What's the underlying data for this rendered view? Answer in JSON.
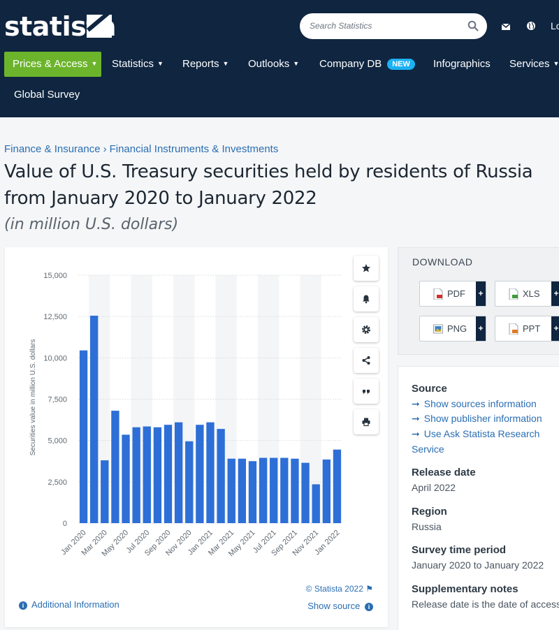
{
  "header": {
    "logo_text": "statista",
    "search_placeholder": "Search Statistics",
    "login_label": "Lo",
    "nav": {
      "prices": "Prices & Access",
      "statistics": "Statistics",
      "reports": "Reports",
      "outlooks": "Outlooks",
      "company_db": "Company DB",
      "new_badge": "NEW",
      "infographics": "Infographics",
      "services": "Services",
      "global_survey": "Global Survey"
    }
  },
  "breadcrumb": {
    "item1": "Finance & Insurance",
    "item2": "Financial Instruments & Investments"
  },
  "page": {
    "title": "Value of U.S. Treasury securities held by residents of Russia from January 2020 to January 2022",
    "subtitle": "(in million U.S. dollars)"
  },
  "chart_footer": {
    "copyright": "© Statista 2022",
    "additional_info": "Additional Information",
    "show_source": "Show source"
  },
  "download": {
    "title": "DOWNLOAD",
    "pdf": "PDF",
    "xls": "XLS",
    "png": "PNG",
    "ppt": "PPT",
    "plus": "+"
  },
  "info": {
    "source_head": "Source",
    "source_links": [
      "Show sources information",
      "Show publisher information",
      "Use Ask Statista Research"
    ],
    "service_text": "Service",
    "release_head": "Release date",
    "release_val": "April 2022",
    "region_head": "Region",
    "region_val": "Russia",
    "survey_head": "Survey time period",
    "survey_val": "January 2020 to January 2022",
    "notes_head": "Supplementary notes",
    "notes_val": "Release date is the date of access."
  },
  "colors": {
    "bar": "#2d6fd6",
    "nav_bg": "#0f2540",
    "accent_green": "#6cb42c",
    "link": "#2a6eb3"
  },
  "chart_data": {
    "type": "bar",
    "ylabel": "Securities value in million U.S. dollars",
    "xlabel": "",
    "ylim": [
      0,
      15000
    ],
    "yticks": [
      0,
      2500,
      5000,
      7500,
      10000,
      12500,
      15000
    ],
    "ytick_labels": [
      "0",
      "2,500",
      "5,000",
      "7,500",
      "10,000",
      "12,500",
      "15,000"
    ],
    "categories": [
      "Jan 2020",
      "Feb 2020",
      "Mar 2020",
      "Apr 2020",
      "May 2020",
      "Jun 2020",
      "Jul 2020",
      "Aug 2020",
      "Sep 2020",
      "Oct 2020",
      "Nov 2020",
      "Dec 2020",
      "Jan 2021",
      "Feb 2021",
      "Mar 2021",
      "Apr 2021",
      "May 2021",
      "Jun 2021",
      "Jul 2021",
      "Aug 2021",
      "Sep 2021",
      "Oct 2021",
      "Nov 2021",
      "Dec 2021",
      "Jan 2022"
    ],
    "values": [
      10450,
      12550,
      3800,
      6800,
      5350,
      5800,
      5850,
      5800,
      5950,
      6100,
      4950,
      5950,
      6100,
      5700,
      3900,
      3900,
      3750,
      3950,
      3950,
      3950,
      3900,
      3650,
      2350,
      3850,
      4450
    ],
    "visible_xtick_labels": [
      "Jan 2020",
      "Mar 2020",
      "May 2020",
      "Jul 2020",
      "Sep 2020",
      "Nov 2020",
      "Jan 2021",
      "Mar 2021",
      "May 2021",
      "Jul 2021",
      "Sep 2021",
      "Nov 2021",
      "Jan 2022"
    ],
    "grid": true
  }
}
